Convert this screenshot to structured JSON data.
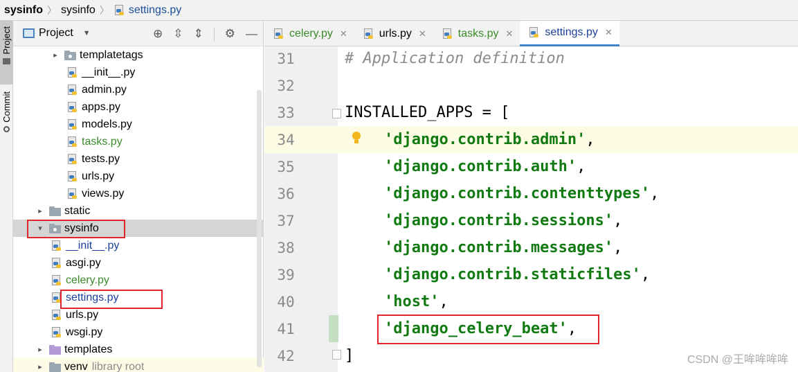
{
  "breadcrumb": {
    "root": "sysinfo",
    "folder": "sysinfo",
    "file": "settings.py"
  },
  "stripe": {
    "project_label": "Project",
    "commit_label": "Commit"
  },
  "project_panel": {
    "title": "Project"
  },
  "tree": [
    {
      "label": "templatetags",
      "kind": "folder",
      "arrow": "›",
      "indent": 1
    },
    {
      "label": "__init__.py",
      "kind": "py",
      "indent": 2
    },
    {
      "label": "admin.py",
      "kind": "py",
      "indent": 2
    },
    {
      "label": "apps.py",
      "kind": "py",
      "indent": 2
    },
    {
      "label": "models.py",
      "kind": "py",
      "indent": 2
    },
    {
      "label": "tasks.py",
      "kind": "py",
      "indent": 2,
      "color": "green"
    },
    {
      "label": "tests.py",
      "kind": "py",
      "indent": 2
    },
    {
      "label": "urls.py",
      "kind": "py",
      "indent": 2
    },
    {
      "label": "views.py",
      "kind": "py",
      "indent": 2
    },
    {
      "label": "static",
      "kind": "folder",
      "arrow": "›",
      "indent": 0
    },
    {
      "label": "sysinfo",
      "kind": "folder",
      "arrow": "⌄",
      "indent": 0,
      "selected": true
    },
    {
      "label": "__init__.py",
      "kind": "py",
      "indent": 1,
      "color": "blue"
    },
    {
      "label": "asgi.py",
      "kind": "py",
      "indent": 1
    },
    {
      "label": "celery.py",
      "kind": "py",
      "indent": 1,
      "color": "green"
    },
    {
      "label": "settings.py",
      "kind": "py",
      "indent": 1,
      "color": "blue"
    },
    {
      "label": "urls.py",
      "kind": "py",
      "indent": 1
    },
    {
      "label": "wsgi.py",
      "kind": "py",
      "indent": 1
    },
    {
      "label": "templates",
      "kind": "folder-purple",
      "arrow": "›",
      "indent": 0
    },
    {
      "label": "venv",
      "kind": "folder",
      "arrow": "›",
      "indent": 0,
      "suffix": "library root"
    }
  ],
  "tabs": [
    {
      "label": "celery.py",
      "color": "green",
      "active": false
    },
    {
      "label": "urls.py",
      "color": "default",
      "active": false
    },
    {
      "label": "tasks.py",
      "color": "green",
      "active": false
    },
    {
      "label": "settings.py",
      "color": "blue",
      "active": true
    }
  ],
  "editor": {
    "lines": [
      {
        "num": "31",
        "text": "# Application definition",
        "type": "comment"
      },
      {
        "num": "32",
        "text": "",
        "type": "plain"
      },
      {
        "num": "33",
        "text": "INSTALLED_APPS = [",
        "type": "plain"
      },
      {
        "num": "34",
        "text": "'django.contrib.admin'",
        "suffix": ",",
        "type": "string",
        "current": true
      },
      {
        "num": "35",
        "text": "'django.contrib.auth'",
        "suffix": ",",
        "type": "string"
      },
      {
        "num": "36",
        "text": "'django.contrib.contenttypes'",
        "suffix": ",",
        "type": "string"
      },
      {
        "num": "37",
        "text": "'django.contrib.sessions'",
        "suffix": ",",
        "type": "string"
      },
      {
        "num": "38",
        "text": "'django.contrib.messages'",
        "suffix": ",",
        "type": "string"
      },
      {
        "num": "39",
        "text": "'django.contrib.staticfiles'",
        "suffix": ",",
        "type": "string"
      },
      {
        "num": "40",
        "text": "'host'",
        "suffix": ",",
        "type": "string"
      },
      {
        "num": "41",
        "text": "'django_celery_beat'",
        "suffix": ",",
        "type": "string"
      },
      {
        "num": "42",
        "text": "]",
        "type": "plain"
      }
    ]
  },
  "watermark": "CSDN @王哞哞哞哞",
  "colors": {
    "string": "#127a12",
    "comment": "#8b8b8b",
    "highlight_box": "#e0262c",
    "active_tab": "#4083c9"
  }
}
